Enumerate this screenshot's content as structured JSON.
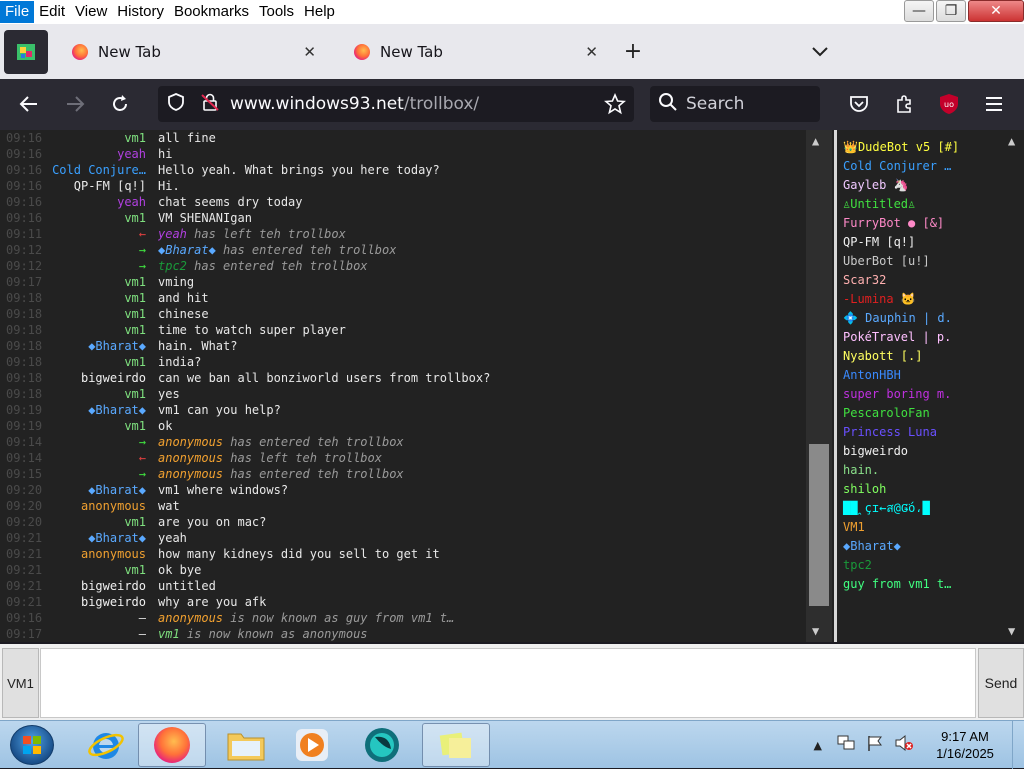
{
  "menubar": {
    "items": [
      "File",
      "Edit",
      "View",
      "History",
      "Bookmarks",
      "Tools",
      "Help"
    ]
  },
  "window_controls": {
    "minimize": "—",
    "maximize": "❐",
    "close": "✕"
  },
  "tabs": [
    {
      "title": "New Tab"
    },
    {
      "title": "New Tab"
    }
  ],
  "url": {
    "host": "www.windows93.net",
    "path": "/trollbox/"
  },
  "search": {
    "placeholder": "Search"
  },
  "messages": [
    {
      "time": "09:16",
      "nick": "vm1",
      "nick_color": "#7fe07f",
      "text": "all fine",
      "sys": false
    },
    {
      "time": "09:16",
      "nick": "yeah",
      "nick_color": "#b040e0",
      "text": "hi",
      "sys": false
    },
    {
      "time": "09:16",
      "nick": "Cold Conjure…",
      "nick_color": "#3aa0ff",
      "text": "Hello yeah. What brings you here today?",
      "sys": false
    },
    {
      "time": "09:16",
      "nick": "QP-FM [q!]",
      "nick_color": "#e8e8e8",
      "text": "Hi.",
      "sys": false
    },
    {
      "time": "09:16",
      "nick": "yeah",
      "nick_color": "#b040e0",
      "text": "chat seems dry today",
      "sys": false
    },
    {
      "time": "09:16",
      "nick": "vm1",
      "nick_color": "#7fe07f",
      "text": "VM SHENANIgan",
      "sys": false
    },
    {
      "time": "09:11",
      "nick": "←",
      "nick_color": "#e04040",
      "text": "yeah has left teh trollbox",
      "sys": true,
      "actor": "yeah",
      "actor_color": "#b040e0"
    },
    {
      "time": "09:12",
      "nick": "→",
      "nick_color": "#40e040",
      "text": "◆Bharat◆ has entered teh trollbox",
      "sys": true,
      "actor": "◆Bharat◆",
      "actor_color": "#5aa9ff"
    },
    {
      "time": "09:12",
      "nick": "→",
      "nick_color": "#40e040",
      "text": "tpc2 has entered teh trollbox",
      "sys": true,
      "actor": "tpc2",
      "actor_color": "#1a9a3a"
    },
    {
      "time": "09:17",
      "nick": "vm1",
      "nick_color": "#7fe07f",
      "text": "vming",
      "sys": false
    },
    {
      "time": "09:18",
      "nick": "vm1",
      "nick_color": "#7fe07f",
      "text": "and hit",
      "sys": false
    },
    {
      "time": "09:18",
      "nick": "vm1",
      "nick_color": "#7fe07f",
      "text": "chinese",
      "sys": false
    },
    {
      "time": "09:18",
      "nick": "vm1",
      "nick_color": "#7fe07f",
      "text": "time to watch super player",
      "sys": false
    },
    {
      "time": "09:18",
      "nick": "◆Bharat◆",
      "nick_color": "#5aa9ff",
      "text": "hain. What?",
      "sys": false
    },
    {
      "time": "09:18",
      "nick": "vm1",
      "nick_color": "#7fe07f",
      "text": "india?",
      "sys": false
    },
    {
      "time": "09:18",
      "nick": "bigweirdo",
      "nick_color": "#f0f0f0",
      "text": "can we ban all bonziworld users from trollbox?",
      "sys": false
    },
    {
      "time": "09:18",
      "nick": "vm1",
      "nick_color": "#7fe07f",
      "text": "yes",
      "sys": false
    },
    {
      "time": "09:19",
      "nick": "◆Bharat◆",
      "nick_color": "#5aa9ff",
      "text": "vm1 can you help?",
      "sys": false
    },
    {
      "time": "09:19",
      "nick": "vm1",
      "nick_color": "#7fe07f",
      "text": "ok",
      "sys": false
    },
    {
      "time": "09:14",
      "nick": "→",
      "nick_color": "#40e040",
      "text": "anonymous has entered teh trollbox",
      "sys": true,
      "actor": "anonymous",
      "actor_color": "#f0a030"
    },
    {
      "time": "09:14",
      "nick": "←",
      "nick_color": "#e04040",
      "text": "anonymous has left teh trollbox",
      "sys": true,
      "actor": "anonymous",
      "actor_color": "#f0a030"
    },
    {
      "time": "09:15",
      "nick": "→",
      "nick_color": "#40e040",
      "text": "anonymous has entered teh trollbox",
      "sys": true,
      "actor": "anonymous",
      "actor_color": "#f0a030"
    },
    {
      "time": "09:20",
      "nick": "◆Bharat◆",
      "nick_color": "#5aa9ff",
      "text": "vm1 where windows?",
      "sys": false
    },
    {
      "time": "09:20",
      "nick": "anonymous",
      "nick_color": "#f0a030",
      "text": "wat",
      "sys": false
    },
    {
      "time": "09:20",
      "nick": "vm1",
      "nick_color": "#7fe07f",
      "text": "are you on mac?",
      "sys": false
    },
    {
      "time": "09:21",
      "nick": "◆Bharat◆",
      "nick_color": "#5aa9ff",
      "text": "yeah",
      "sys": false
    },
    {
      "time": "09:21",
      "nick": "anonymous",
      "nick_color": "#f0a030",
      "text": "how many kidneys did you sell to get it",
      "sys": false
    },
    {
      "time": "09:21",
      "nick": "vm1",
      "nick_color": "#7fe07f",
      "text": "ok bye",
      "sys": false
    },
    {
      "time": "09:21",
      "nick": "bigweirdo",
      "nick_color": "#f0f0f0",
      "text": "untitled",
      "sys": false
    },
    {
      "time": "09:21",
      "nick": "bigweirdo",
      "nick_color": "#f0f0f0",
      "text": "why are you afk",
      "sys": false
    },
    {
      "time": "09:16",
      "nick": "–",
      "nick_color": "#e0e0e0",
      "text": "anonymous is now known as guy from vm1 t…",
      "sys": true,
      "actor": "anonymous",
      "actor_color": "#f0a030"
    },
    {
      "time": "09:17",
      "nick": "–",
      "nick_color": "#e0e0e0",
      "text": "vm1 is now known as anonymous",
      "sys": true,
      "actor": "vm1",
      "actor_color": "#7fe07f"
    }
  ],
  "users": [
    {
      "name": "👑DudeBot v5 [#]",
      "color": "#ffff40"
    },
    {
      "name": "Cold Conjurer …",
      "color": "#3aa0ff"
    },
    {
      "name": "Gayleb 🦄",
      "color": "#f0c8ff"
    },
    {
      "name": "♙Untitled♙",
      "color": "#40e040"
    },
    {
      "name": "FurryBot ● [&]",
      "color": "#ff8ac8"
    },
    {
      "name": "QP-FM [q!]",
      "color": "#f0f0f0"
    },
    {
      "name": "UberBot [u!]",
      "color": "#c8c8c8"
    },
    {
      "name": "Scar32",
      "color": "#ffb0b0"
    },
    {
      "name": "-Lumina 🐱",
      "color": "#e02020"
    },
    {
      "name": "💠 Dauphin | d.",
      "color": "#5aa9ff"
    },
    {
      "name": "PokéTravel | p.",
      "color": "#ffc0ff"
    },
    {
      "name": "Nyabott [.]",
      "color": "#ffff60"
    },
    {
      "name": "AntonHBH",
      "color": "#3a8aff"
    },
    {
      "name": "super boring m.",
      "color": "#c030e0"
    },
    {
      "name": "PescaroloFan",
      "color": "#40e040"
    },
    {
      "name": "Princess Luna",
      "color": "#6a50ff"
    },
    {
      "name": "bigweirdo",
      "color": "#f0f0f0"
    },
    {
      "name": "hain.",
      "color": "#8ae08a"
    },
    {
      "name": "shiloh",
      "color": "#80ff60"
    },
    {
      "name": "██ꞈçɪ←ส@Ǥ̈ó،█",
      "color": "#00ffff"
    },
    {
      "name": "VM1",
      "color": "#f0a030"
    },
    {
      "name": "◆Bharat◆",
      "color": "#5aa9ff"
    },
    {
      "name": "tpc2",
      "color": "#1a9a3a"
    },
    {
      "name": "guy from vm1 t…",
      "color": "#40ff80"
    }
  ],
  "input": {
    "nick_label": "VM1",
    "send_label": "Send"
  },
  "clock": {
    "time": "9:17 AM",
    "date": "1/16/2025"
  },
  "icons": [
    "app-icon",
    "firefox-icon",
    "close-icon",
    "plus-icon",
    "chevron-down-icon",
    "back-arrow-icon",
    "forward-arrow-icon",
    "reload-icon",
    "shield-icon",
    "lock-broken-icon",
    "star-icon",
    "search-icon",
    "pocket-icon",
    "extensions-icon",
    "ublock-icon",
    "hamburger-menu-icon",
    "start-orb-icon",
    "ie-icon",
    "firefox-taskbar-icon",
    "explorer-icon",
    "media-player-icon",
    "windows93-icon",
    "sticky-notes-icon",
    "tray-up-icon",
    "network-icon",
    "flag-icon",
    "volume-muted-icon"
  ]
}
